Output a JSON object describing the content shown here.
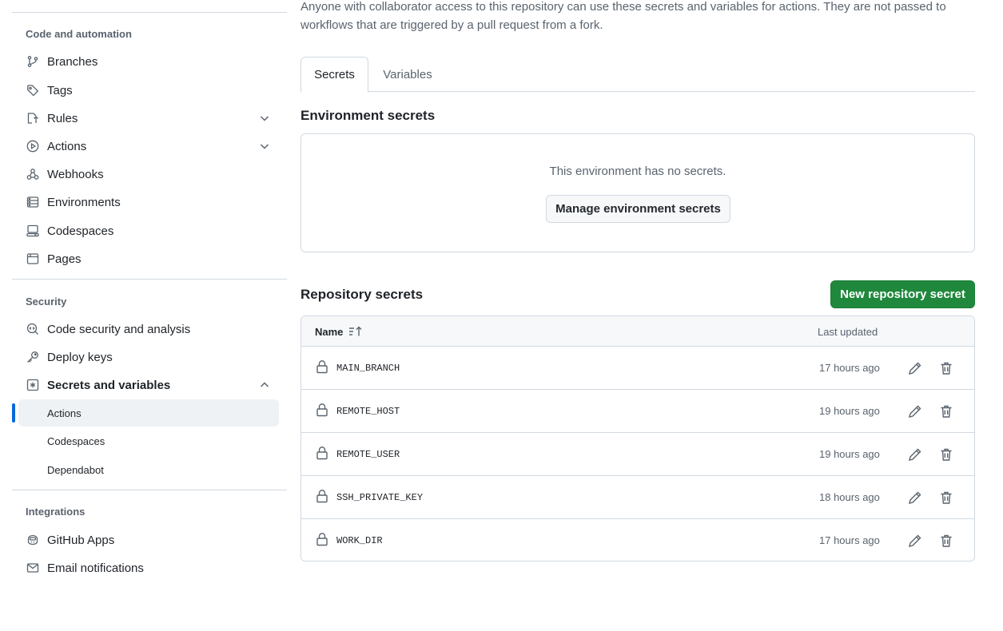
{
  "sidebar": {
    "code_heading": "Code and automation",
    "code_items": [
      {
        "label": "Branches",
        "icon": "branch-icon"
      },
      {
        "label": "Tags",
        "icon": "tag-icon"
      },
      {
        "label": "Rules",
        "icon": "rules-icon"
      },
      {
        "label": "Actions",
        "icon": "play-icon"
      },
      {
        "label": "Webhooks",
        "icon": "webhook-icon"
      },
      {
        "label": "Environments",
        "icon": "server-icon"
      },
      {
        "label": "Codespaces",
        "icon": "codespaces-icon"
      },
      {
        "label": "Pages",
        "icon": "browser-icon"
      }
    ],
    "security_heading": "Security",
    "security_items": [
      {
        "label": "Code security and analysis",
        "icon": "codescan-icon"
      },
      {
        "label": "Deploy keys",
        "icon": "key-icon"
      },
      {
        "label": "Secrets and variables",
        "icon": "asterisk-icon"
      }
    ],
    "secrets_sub_items": [
      "Actions",
      "Codespaces",
      "Dependabot"
    ],
    "active_sub_item": "Actions",
    "integrations_heading": "Integrations",
    "integration_items": [
      {
        "label": "GitHub Apps",
        "icon": "copilot-app-icon"
      },
      {
        "label": "Email notifications",
        "icon": "mail-icon"
      }
    ]
  },
  "main": {
    "intro_text": "Anyone with collaborator access to this repository can use these secrets and variables for actions. They are not passed to workflows that are triggered by a pull request from a fork.",
    "tabs": [
      "Secrets",
      "Variables"
    ],
    "selected_tab": "Secrets",
    "environment_secrets": {
      "title": "Environment secrets",
      "empty_text": "This environment has no secrets.",
      "manage_button": "Manage environment secrets"
    },
    "repository_secrets": {
      "title": "Repository secrets",
      "new_button": "New repository secret",
      "columns": {
        "name": "Name",
        "last_updated": "Last updated"
      },
      "rows": [
        {
          "name": "MAIN_BRANCH",
          "updated": "17 hours ago"
        },
        {
          "name": "REMOTE_HOST",
          "updated": "19 hours ago"
        },
        {
          "name": "REMOTE_USER",
          "updated": "19 hours ago"
        },
        {
          "name": "SSH_PRIVATE_KEY",
          "updated": "18 hours ago"
        },
        {
          "name": "WORK_DIR",
          "updated": "17 hours ago"
        }
      ]
    }
  },
  "colors": {
    "primary_button": "#1f883d",
    "active_indicator": "#0969da",
    "muted_text": "#59636e",
    "border": "#d1d9e0"
  }
}
